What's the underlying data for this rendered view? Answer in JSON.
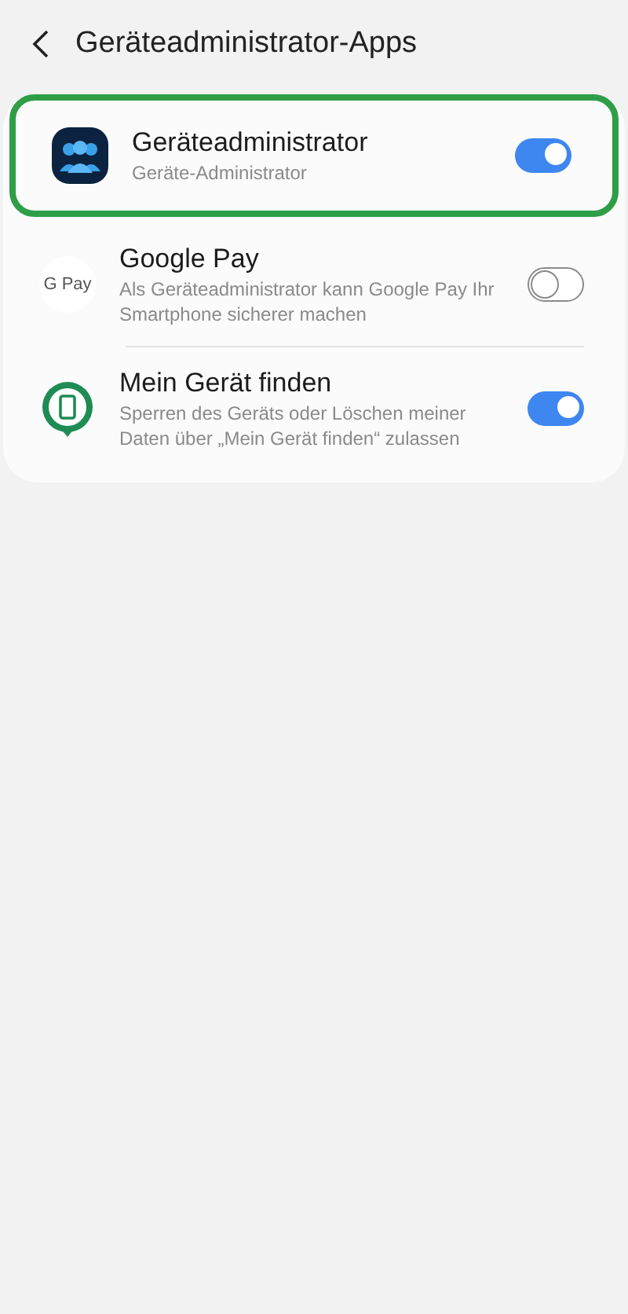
{
  "header": {
    "title": "Geräteadministrator-Apps"
  },
  "apps": [
    {
      "kind": "admin",
      "title": "Geräteadministrator",
      "subtitle": "Geräte-Administrator",
      "on": true,
      "highlighted": true
    },
    {
      "kind": "gpay",
      "logo_text": "G Pay",
      "title": "Google Pay",
      "subtitle": "Als Geräteadministrator kann Google Pay Ihr Smartphone sicherer machen",
      "on": false,
      "highlighted": false
    },
    {
      "kind": "find",
      "title": "Mein Gerät finden",
      "subtitle": "Sperren des Geräts oder Löschen meiner Daten über „Mein Gerät finden“ zulassen",
      "on": true,
      "highlighted": false
    }
  ]
}
